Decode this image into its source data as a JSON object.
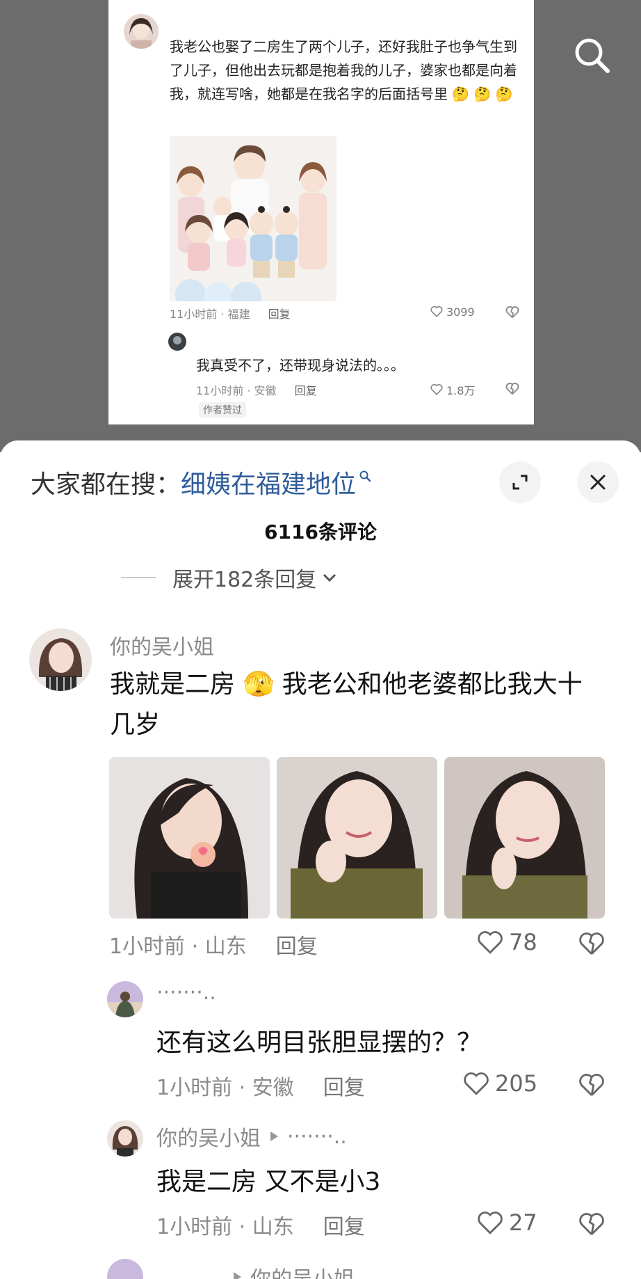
{
  "embedded_post": {
    "text": "我老公也娶了二房生了两个儿子，还好我肚子也争气生到了儿子，但他出去玩都是抱着我的儿子，婆家也都是向着我，就连写啥，她都是在我名字的后面括号里",
    "meta_time": "11小时前 · 福建",
    "reply_label": "回复",
    "like_count": "3099",
    "reply_text": "我真受不了，还带现身说法的。。。",
    "reply_meta_time": "11小时前 · 安徽",
    "reply_like_count": "1.8万",
    "author_liked": "作者赞过"
  },
  "sheet": {
    "search_prefix": "大家都在搜：",
    "search_term": "细姨在福建地位",
    "comment_count": "6116条评论",
    "expand_replies": "展开182条回复"
  },
  "comments": [
    {
      "username": "你的吴小姐",
      "text": "我就是二房 我老公和他老婆都比我大十几岁",
      "text_line1": "我就是二房",
      "text_line1b": "我老公和他老婆都比我大十",
      "text_line2": "几岁",
      "time": "1小时前 · 山东",
      "reply": "回复",
      "likes": "78"
    },
    {
      "username": "·······..",
      "text": "还有这么明目张胆显摆的？？",
      "time": "1小时前 · 安徽",
      "reply": "回复",
      "likes": "205"
    },
    {
      "username": "你的吴小姐",
      "reply_to": "·······..",
      "text": "我是二房 又不是小3",
      "time": "1小时前 · 山东",
      "reply": "回复",
      "likes": "27"
    },
    {
      "username": "",
      "reply_to": "你的吴小姐"
    }
  ],
  "icons": {
    "search": "search-icon",
    "expand": "expand-icon",
    "close": "close-icon",
    "like": "heart-icon",
    "dislike": "broken-heart-icon",
    "chevron": "chevron-down-icon",
    "reply_arrow": "play-arrow-icon"
  },
  "colors": {
    "overlay": "#6c6c6c",
    "search_term": "#2f5d9b",
    "secondary_text": "#8a8a8a"
  }
}
